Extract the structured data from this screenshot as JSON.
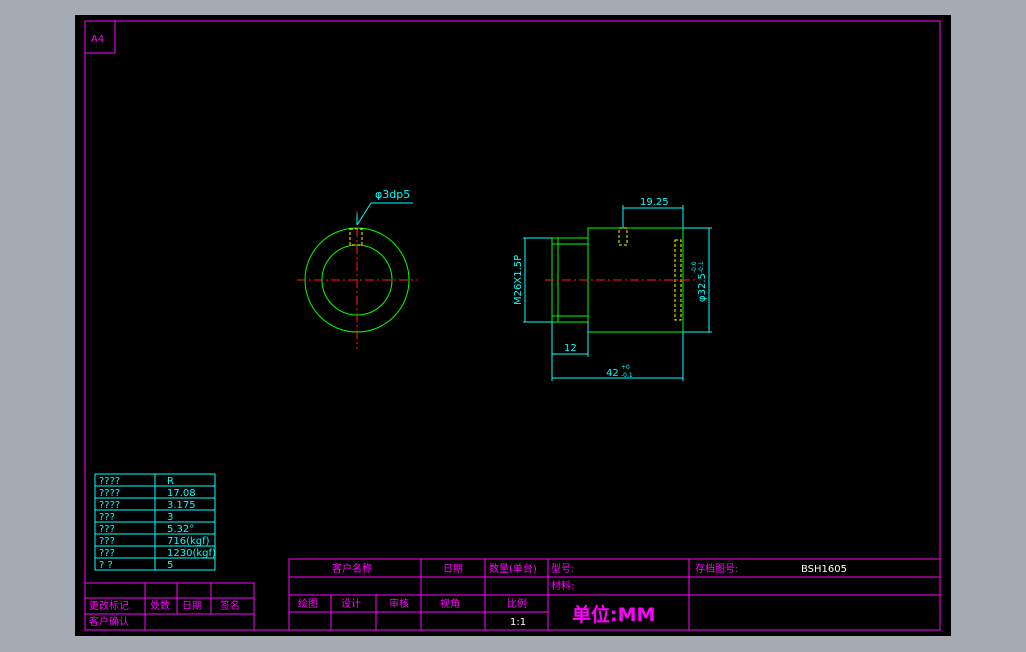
{
  "sheet": {
    "size_label": "A4"
  },
  "drawing": {
    "labels": {
      "pin_hole": "φ3dp5",
      "dim_19_25": "19.25",
      "thread": "M26X1.5P",
      "dim_12": "12",
      "dim_42": "42",
      "dim_42_tol_upper": "+0",
      "dim_42_tol_lower": "-0.1",
      "dia_32_5": "φ32.5",
      "dia_32_5_tol_upper": "-0.0",
      "dia_32_5_tol_lower": "-0.1"
    }
  },
  "spec_table": {
    "rows": [
      {
        "key": "????",
        "value": "R"
      },
      {
        "key": "????",
        "value": "17.08"
      },
      {
        "key": "????",
        "value": "3.175"
      },
      {
        "key": "???",
        "value": "3"
      },
      {
        "key": "???",
        "value": "5.32°"
      },
      {
        "key": "???",
        "value": "716(kgf)"
      },
      {
        "key": "???",
        "value": "1230(kgf)"
      },
      {
        "key": "? ?",
        "value": "5"
      }
    ]
  },
  "revision_block": {
    "change_mark": "更改标记",
    "location": "处数",
    "date": "日期",
    "signature": "签名",
    "customer_confirm": "客户确认"
  },
  "title_block": {
    "customer_name": "客户名称",
    "date": "日期",
    "quantity": "数量(单台)",
    "model": "型号:",
    "archive_no_label": "存档图号:",
    "archive_no": "BSH1605",
    "material": "材料:",
    "drawn": "绘图",
    "design": "设计",
    "review": "审核",
    "view_angle": "视角",
    "scale_label": "比例",
    "scale_value": "1:1",
    "unit": "单位:MM"
  }
}
